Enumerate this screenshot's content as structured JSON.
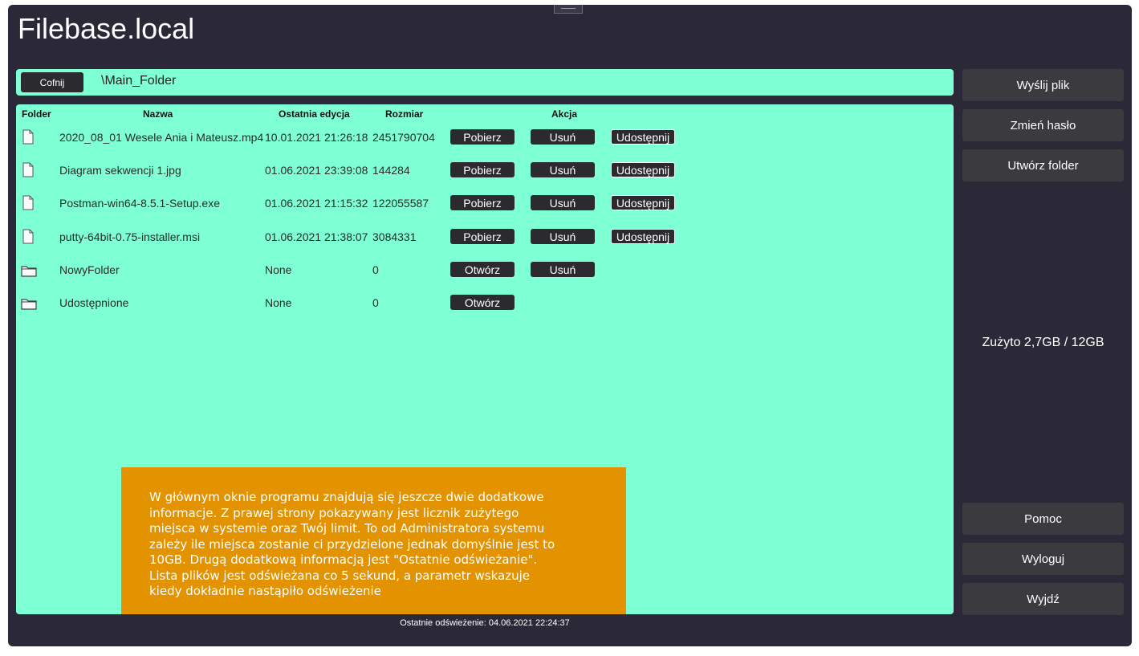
{
  "app": {
    "title": "Filebase.local"
  },
  "navigation": {
    "back_label": "Cofnij",
    "current_path": "\\Main_Folder"
  },
  "table": {
    "headers": {
      "folder": "Folder",
      "name": "Nazwa",
      "modified": "Ostatnia edycja",
      "size": "Rozmiar",
      "action": "Akcja"
    },
    "rows": [
      {
        "type": "file",
        "icon": "file-icon",
        "name": "2020_08_01 Wesele Ania i Mateusz.mp4",
        "modified": "10.01.2021 21:26:18",
        "size": "2451790704",
        "actions": [
          "Pobierz",
          "Usuń",
          "Udostępnij"
        ]
      },
      {
        "type": "file",
        "icon": "file-icon",
        "name": "Diagram sekwencji 1.jpg",
        "modified": "01.06.2021 23:39:08",
        "size": "144284",
        "actions": [
          "Pobierz",
          "Usuń",
          "Udostępnij"
        ]
      },
      {
        "type": "file",
        "icon": "file-icon",
        "name": "Postman-win64-8.5.1-Setup.exe",
        "modified": "01.06.2021 21:15:32",
        "size": "122055587",
        "actions": [
          "Pobierz",
          "Usuń",
          "Udostępnij"
        ]
      },
      {
        "type": "file",
        "icon": "file-icon",
        "name": "putty-64bit-0.75-installer.msi",
        "modified": "01.06.2021 21:38:07",
        "size": "3084331",
        "actions": [
          "Pobierz",
          "Usuń",
          "Udostępnij"
        ]
      },
      {
        "type": "folder",
        "icon": "folder-icon",
        "name": "NowyFolder",
        "modified": "None",
        "size": "0",
        "actions": [
          "Otwórz",
          "Usuń"
        ]
      },
      {
        "type": "folder",
        "icon": "folder-icon",
        "name": "Udostępnione",
        "modified": "None",
        "size": "0",
        "actions": [
          "Otwórz"
        ]
      }
    ]
  },
  "tooltip": {
    "lines": [
      "W głównym oknie programu znajdują się jeszcze dwie dodatkowe",
      "informacje. Z prawej strony pokazywany jest licznik zużytego",
      "miejsca w systemie oraz Twój limit. To od Administratora systemu",
      "zależy ile miejsca zostanie ci przydzielone jednak domyślnie jest to",
      "10GB. Drugą dodatkową informacją jest \"Ostatnie odświeżanie\".",
      "Lista plików jest odświeżana co 5 sekund, a parametr wskazuje",
      "kiedy dokładnie nastąpiło odświeżenie"
    ]
  },
  "sidebar": {
    "upload_label": "Wyślij plik",
    "change_password_label": "Zmień hasło",
    "create_folder_label": "Utwórz folder",
    "usage_text": "Zużyto 2,7GB / 12GB",
    "help_label": "Pomoc",
    "logout_label": "Wyloguj",
    "exit_label": "Wyjdź"
  },
  "status": {
    "last_refresh": "Ostatnie odświeżenie: 04.06.2021 22:24:37"
  },
  "colors": {
    "panel": "#7fffd4",
    "window": "#2b2838",
    "tooltip": "#e39200",
    "button": "#2b2a2f"
  }
}
